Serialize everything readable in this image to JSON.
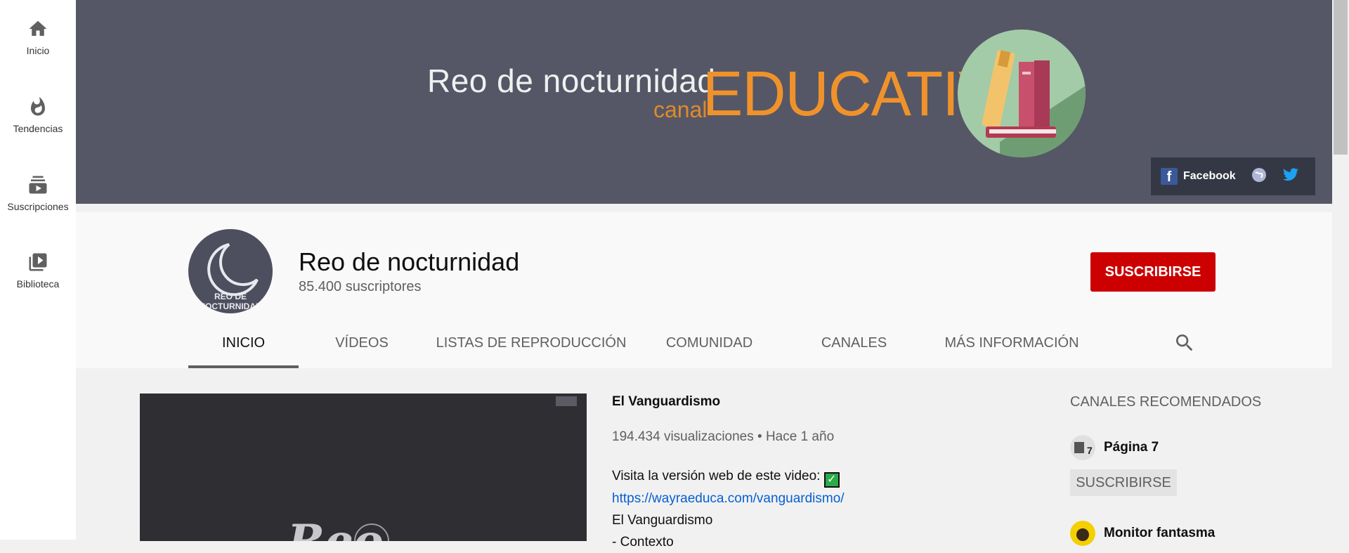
{
  "guide": {
    "items": [
      {
        "label": "Inicio",
        "icon": "home-icon"
      },
      {
        "label": "Tendencias",
        "icon": "trending-icon"
      },
      {
        "label": "Suscripciones",
        "icon": "subscriptions-icon"
      },
      {
        "label": "Biblioteca",
        "icon": "library-icon"
      }
    ]
  },
  "banner": {
    "name": "Reo de nocturnidad",
    "canal": "canal",
    "educativo": "EDUCATIVO",
    "links": {
      "facebook": "Facebook"
    }
  },
  "channel": {
    "name": "Reo de nocturnidad",
    "subscribers": "85.400 suscriptores",
    "avatar_text": "REO DE NOCTURNIDAD",
    "subscribe_label": "SUSCRIBIRSE"
  },
  "tabs": [
    {
      "label": "INICIO",
      "active": true
    },
    {
      "label": "VÍDEOS"
    },
    {
      "label": "LISTAS DE REPRODUCCIÓN"
    },
    {
      "label": "COMUNIDAD"
    },
    {
      "label": "CANALES"
    },
    {
      "label": "MÁS INFORMACIÓN"
    }
  ],
  "featured": {
    "title": "El Vanguardismo",
    "meta": "194.434 visualizaciones • Hace 1 año",
    "desc_line1": "Visita la versión web de este video:",
    "check_glyph": "✓",
    "link": "https://wayraeduca.com/vanguardismo/",
    "desc_line3": "El Vanguardismo",
    "desc_line4": "- Contexto",
    "thumb_text": "Reo"
  },
  "recommended": {
    "title": "CANALES RECOMENDADOS",
    "items": [
      {
        "name": "Página 7",
        "subscribe_label": "SUSCRIBIRSE"
      },
      {
        "name": "Monitor fantasma"
      }
    ]
  },
  "colors": {
    "brand_red": "#cc0000",
    "banner_bg": "#555766",
    "link_blue": "#065fd4",
    "accent_orange": "#f0922b"
  }
}
